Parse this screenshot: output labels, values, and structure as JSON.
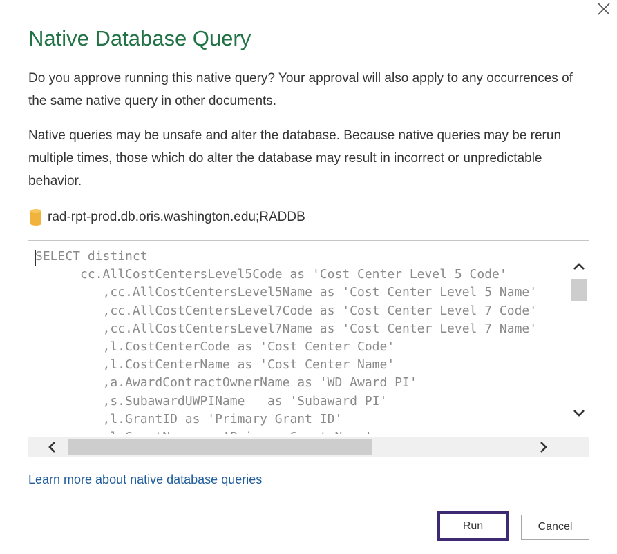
{
  "dialog": {
    "title": "Native Database Query",
    "close_icon": "close-icon",
    "approval_text": "Do you approve running this native query? Your approval will also apply to any occurrences of the same native query in other documents.",
    "warning_text": "Native queries may be unsafe and alter the database. Because native queries may be rerun multiple times, those which do alter the database may result in incorrect or unpredictable behavior.",
    "source": {
      "icon": "database-icon",
      "label": "rad-rpt-prod.db.oris.washington.edu;RADDB"
    },
    "query_lines": [
      "SELECT distinct",
      "      cc.AllCostCentersLevel5Code as 'Cost Center Level 5 Code'",
      "         ,cc.AllCostCentersLevel5Name as 'Cost Center Level 5 Name'",
      "         ,cc.AllCostCentersLevel7Code as 'Cost Center Level 7 Code'",
      "         ,cc.AllCostCentersLevel7Name as 'Cost Center Level 7 Name'",
      "         ,l.CostCenterCode as 'Cost Center Code'",
      "         ,l.CostCenterName as 'Cost Center Name'",
      "         ,a.AwardContractOwnerName as 'WD Award PI'",
      "         ,s.SubawardUWPIName   as 'Subaward PI'",
      "         ,l.GrantID as 'Primary Grant ID'",
      "         ,l.GrantName as 'Primary Grant Name'"
    ],
    "learn_more_link": "Learn more about native database queries",
    "buttons": {
      "run": "Run",
      "cancel": "Cancel"
    },
    "colors": {
      "title": "#217346",
      "link": "#1f5c99",
      "focus_border": "#3d2a73"
    }
  }
}
